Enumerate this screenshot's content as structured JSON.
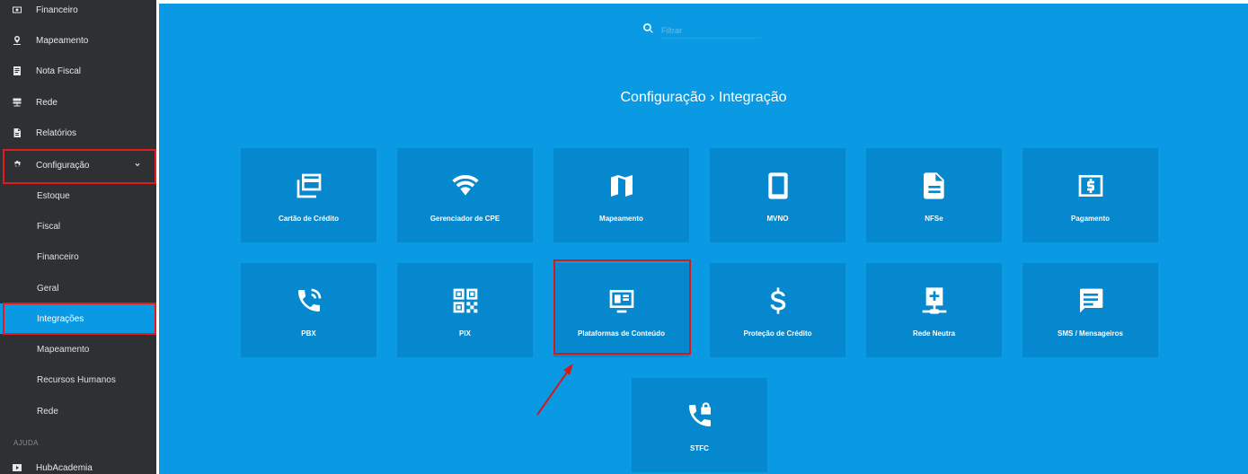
{
  "sidebar": {
    "top_items": [
      {
        "label": "Financeiro",
        "icon": "money-icon"
      },
      {
        "label": "Mapeamento",
        "icon": "map-pin-icon"
      },
      {
        "label": "Nota Fiscal",
        "icon": "receipt-icon"
      },
      {
        "label": "Rede",
        "icon": "network-icon"
      },
      {
        "label": "Relatórios",
        "icon": "report-icon"
      }
    ],
    "config": {
      "label": "Configuração",
      "icon": "gear-icon"
    },
    "sub_items": [
      "Estoque",
      "Fiscal",
      "Financeiro",
      "Geral",
      "Integrações",
      "Mapeamento",
      "Recursos Humanos",
      "Rede"
    ],
    "active_sub": "Integrações",
    "section_label": "AJUDA",
    "help_item": {
      "label": "HubAcademia",
      "icon": "play-icon"
    }
  },
  "search": {
    "placeholder": "Filtrar"
  },
  "breadcrumb": "Configuração › Integração",
  "tiles": [
    {
      "label": "Cartão de Crédito",
      "icon": "credit-card-icon"
    },
    {
      "label": "Gerenciador de CPE",
      "icon": "wifi-icon"
    },
    {
      "label": "Mapeamento",
      "icon": "map-icon"
    },
    {
      "label": "MVNO",
      "icon": "smartphone-icon"
    },
    {
      "label": "NFSe",
      "icon": "document-icon"
    },
    {
      "label": "Pagamento",
      "icon": "payment-icon"
    },
    {
      "label": "PBX",
      "icon": "phone-ringing-icon"
    },
    {
      "label": "PIX",
      "icon": "qr-code-icon"
    },
    {
      "label": "Plataformas de Conteúdo",
      "icon": "monitor-icon"
    },
    {
      "label": "Proteção de Crédito",
      "icon": "dollar-icon"
    },
    {
      "label": "Rede Neutra",
      "icon": "network-plus-icon"
    },
    {
      "label": "SMS / Mensageiros",
      "icon": "message-icon"
    },
    {
      "label": "STFC",
      "icon": "phone-lock-icon"
    }
  ],
  "colors": {
    "sidebar": "#2f3033",
    "main": "#0a9ae4",
    "tile": "#0588ce",
    "highlight": "#d11b1b"
  }
}
